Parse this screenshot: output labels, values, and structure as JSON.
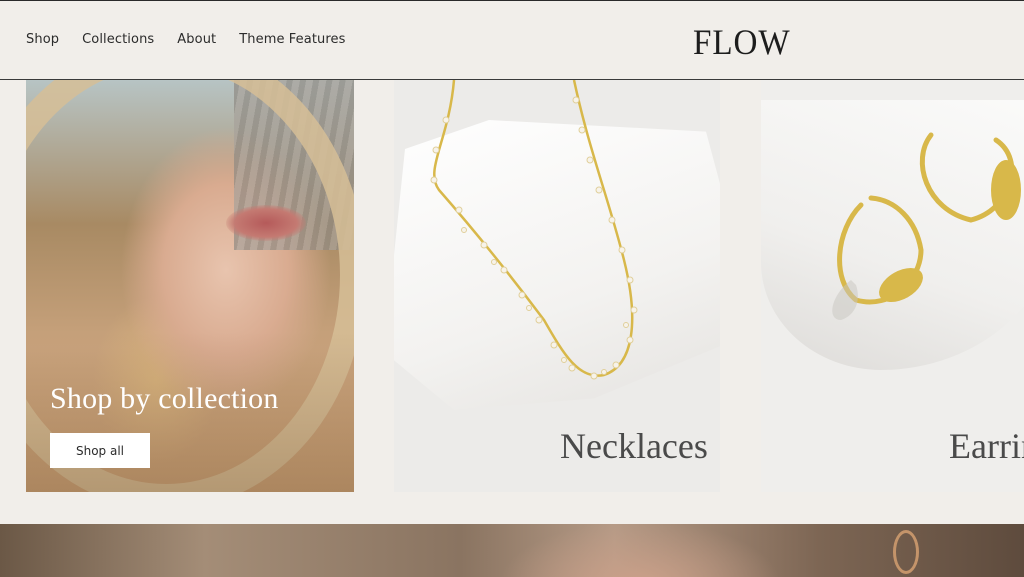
{
  "header": {
    "nav": [
      "Shop",
      "Collections",
      "About",
      "Theme Features"
    ],
    "logo": "FLOW"
  },
  "cards": [
    {
      "title": "Shop by collection",
      "button": "Shop all"
    },
    {
      "label": "Necklaces"
    },
    {
      "label": "Earrin"
    }
  ],
  "colors": {
    "background": "#f1eeea",
    "text": "#2b2b2b",
    "gold": "#d8b84a"
  }
}
